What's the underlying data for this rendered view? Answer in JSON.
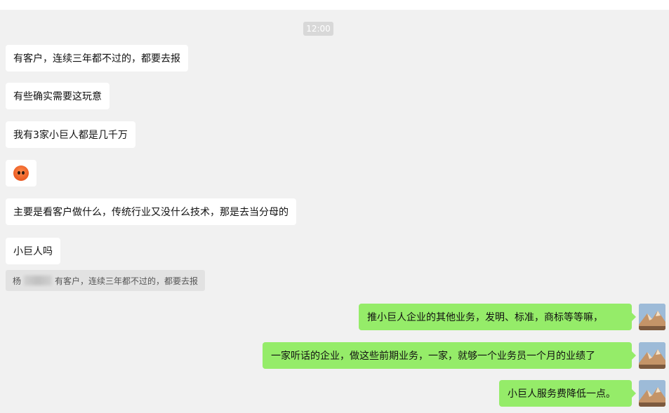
{
  "time_divider": "12:00",
  "incoming_messages": [
    {
      "text": "有客户，连续三年都不过的，都要去报"
    },
    {
      "text": "有些确实需要这玩意"
    },
    {
      "text": "我有3家小巨人都是几千万"
    },
    {
      "emoji": "face-emoji"
    },
    {
      "text": "主要是看客户做什么，传统行业又没什么技术，那是去当分母的"
    },
    {
      "text": "小巨人吗"
    }
  ],
  "quote": {
    "sender_initial": "杨",
    "text": "有客户，连续三年都不过的，都要去报"
  },
  "outgoing_messages": [
    {
      "text": "推小巨人企业的其他业务，发明、标准，商标等等嘛，"
    },
    {
      "text": "一家听话的企业，做这些前期业务，一家，就够一个业务员一个月的业绩了"
    },
    {
      "text": "小巨人服务费降低一点。"
    }
  ],
  "colors": {
    "background": "#f1f1f1",
    "incoming_bubble": "#ffffff",
    "outgoing_bubble": "#95ec69",
    "quote_bg": "#e2e2e2"
  }
}
